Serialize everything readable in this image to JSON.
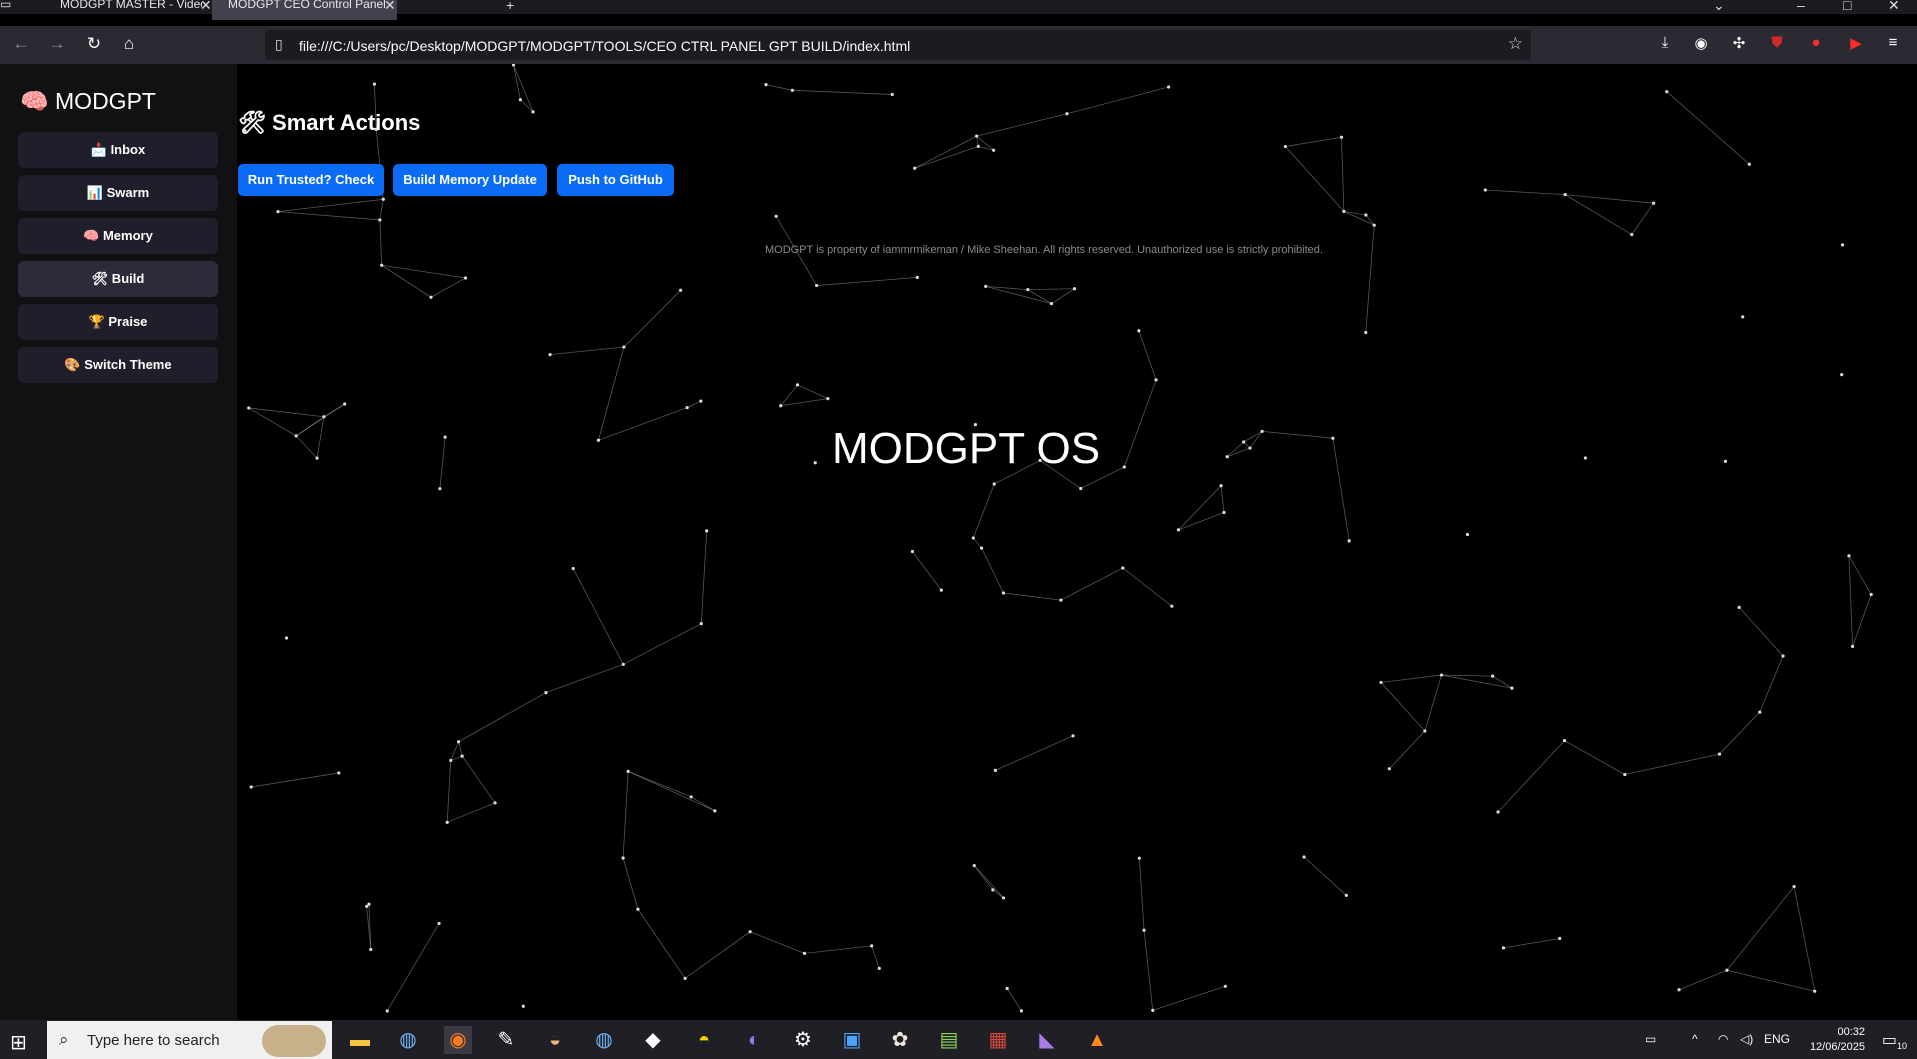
{
  "browser": {
    "tabs": [
      {
        "title": "MODGPT MASTER - Video not"
      },
      {
        "title": "MODGPT CEO Control Panel"
      }
    ],
    "url": "file:///C:/Users/pc/Desktop/MODGPT/MODGPT/TOOLS/CEO CTRL PANEL GPT BUILD/index.html"
  },
  "sidebar": {
    "brand": "🧠 MODGPT",
    "items": [
      {
        "label": "📩 Inbox"
      },
      {
        "label": "📊 Swarm"
      },
      {
        "label": "🧠 Memory"
      },
      {
        "label": "🛠 Build"
      },
      {
        "label": "🏆 Praise"
      },
      {
        "label": "🎨 Switch Theme"
      }
    ]
  },
  "main": {
    "section_title": "🛠 Smart Actions",
    "actions": [
      {
        "label": "Run Trusted? Check"
      },
      {
        "label": "Build Memory Update"
      },
      {
        "label": "Push to GitHub"
      }
    ],
    "copyright": "MODGPT is property of iammrmikeman / Mike Sheehan. All rights reserved. Unauthorized use is strictly prohibited.",
    "hero": "MODGPT OS"
  },
  "taskbar": {
    "search_placeholder": "Type here to search",
    "language": "ENG",
    "time": "00:32",
    "date": "12/06/2025",
    "notifications": "10"
  },
  "colors": {
    "accent": "#0a6cf5",
    "sidebar_bg": "#111114",
    "nav_button_bg": "#1f1f2b"
  }
}
